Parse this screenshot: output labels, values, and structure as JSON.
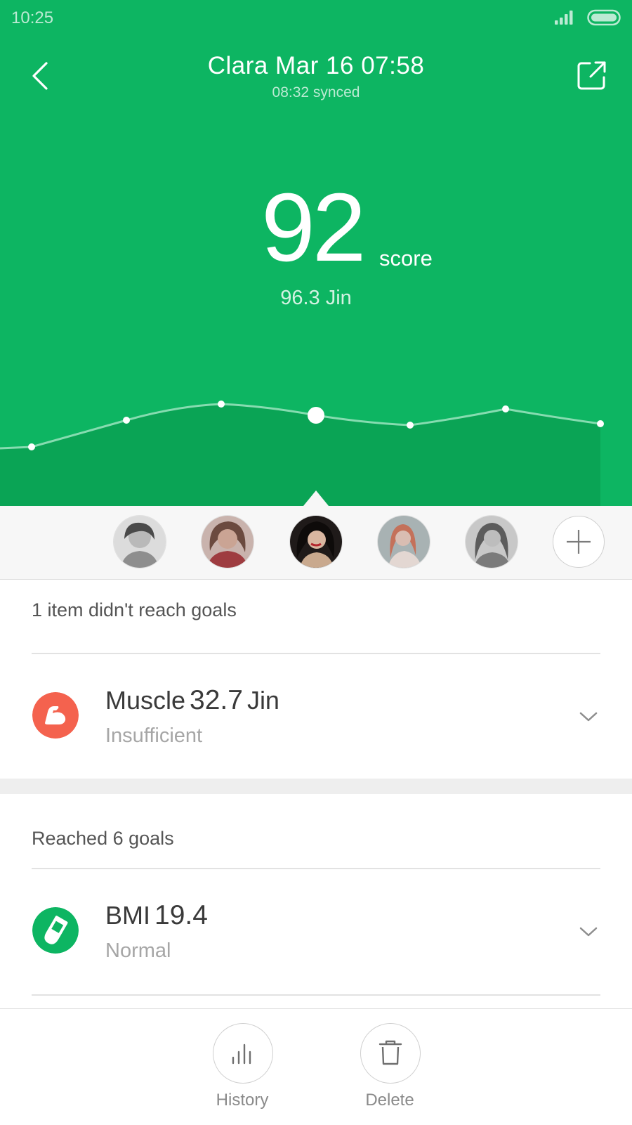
{
  "status_bar": {
    "time": "10:25",
    "signal_icon": "signal-icon",
    "battery_icon": "battery-icon"
  },
  "header": {
    "title": "Clara Mar 16 07:58",
    "subtitle": "08:32 synced",
    "back_icon": "chevron-left-icon",
    "share_icon": "share-icon",
    "accent_color": "#0db562"
  },
  "summary": {
    "score": "92",
    "score_unit": "score",
    "weight": "96.3 Jin"
  },
  "avatars": {
    "selected_index": 2,
    "items": [
      {
        "name": "avatar-1"
      },
      {
        "name": "avatar-2"
      },
      {
        "name": "avatar-3"
      },
      {
        "name": "avatar-4"
      },
      {
        "name": "avatar-5"
      }
    ],
    "add_icon": "plus-icon"
  },
  "sections": {
    "unmet": {
      "label": "1 item didn't reach goals",
      "items": [
        {
          "name": "Muscle",
          "value": "32.7",
          "unit": "Jin",
          "status": "Insufficient",
          "icon": "muscle-icon",
          "icon_color": "#f4624e"
        }
      ]
    },
    "met": {
      "label": "Reached 6 goals",
      "items": [
        {
          "name": "BMI",
          "value": "19.4",
          "unit": "",
          "status": "Normal",
          "icon": "bmi-icon",
          "icon_color": "#0db562"
        }
      ]
    }
  },
  "actions": {
    "history": {
      "label": "History",
      "icon": "bar-chart-icon"
    },
    "delete": {
      "label": "Delete",
      "icon": "trash-icon"
    }
  }
}
